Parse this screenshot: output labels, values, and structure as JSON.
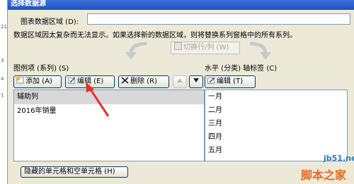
{
  "sheet_row_numbers": [
    "21",
    "3",
    "4",
    "1"
  ],
  "dialog": {
    "title": "选择数据源",
    "range_label": "图表数据区域 (D):",
    "range_value": "",
    "warning": "数据区域因太复杂而无法显示。如果选择新的数据区域，则将替换系列窗格中的所有系列。",
    "switch_label": "切换行/列 (W)"
  },
  "series_pane": {
    "label": "图例项 (系列) (S)",
    "add_label": "添加 (A)",
    "edit_label": "编辑 (E)",
    "delete_label": "删除 (R)",
    "up_icon": "up-arrow-icon",
    "down_icon": "down-arrow-icon",
    "items": [
      {
        "label": "辅助列",
        "selected": true
      },
      {
        "label": "2016年销量",
        "selected": false
      }
    ]
  },
  "category_pane": {
    "label": "水平 (分类) 轴标签 (C)",
    "edit_label": "编辑 (T)",
    "items": [
      "一月",
      "二月",
      "三月",
      "四月",
      "五月"
    ]
  },
  "hidden_cells_label": "隐藏的单元格和空单元格 (H)",
  "watermark": {
    "site": "jb51.net",
    "brand": "脚本之家"
  },
  "colors": {
    "annotation_arrow": "#e8302a",
    "dialog_bg": "#ece9d8",
    "title_bar": "#2a5cd0"
  }
}
